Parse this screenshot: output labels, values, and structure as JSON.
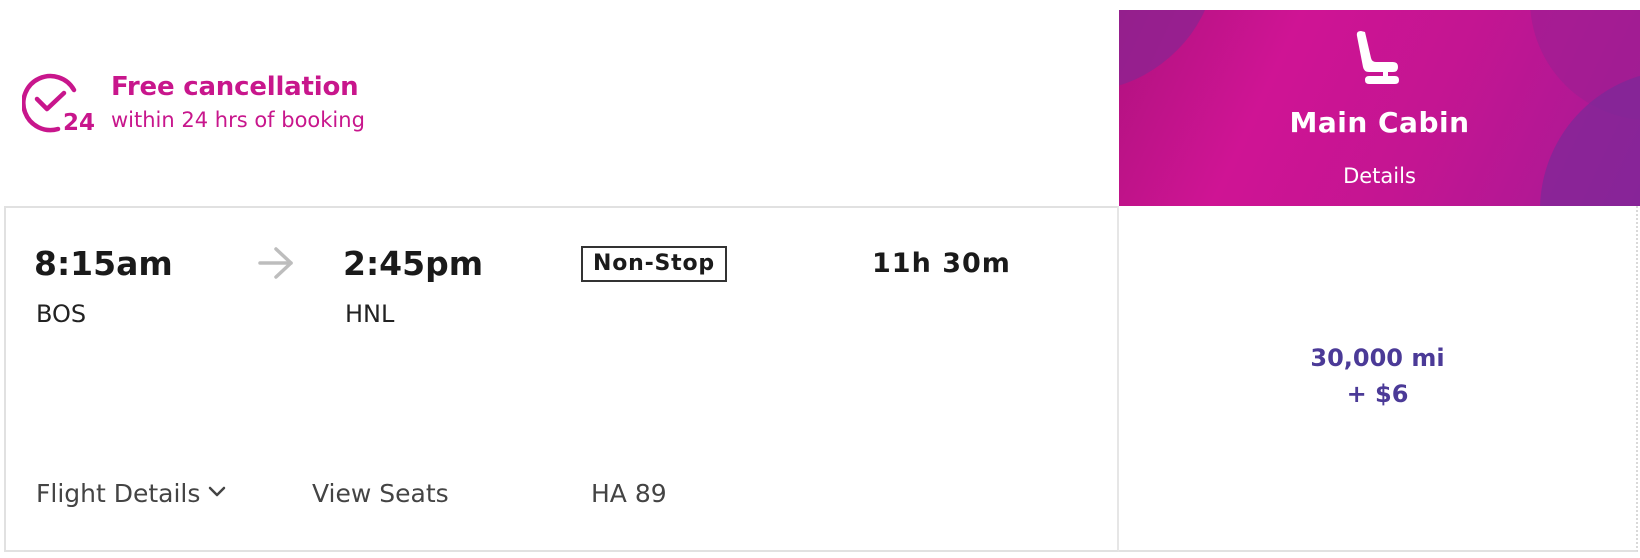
{
  "cancellation": {
    "icon": "clock-check-24-icon",
    "icon_number": "24",
    "title": "Free cancellation",
    "subtitle": "within 24 hrs of booking"
  },
  "cabin": {
    "icon": "seat-icon",
    "title": "Main Cabin",
    "details_label": "Details"
  },
  "flight": {
    "depart_time": "8:15am",
    "depart_airport": "BOS",
    "arrive_time": "2:45pm",
    "arrive_airport": "HNL",
    "stops_label": "Non-Stop",
    "duration": "11h 30m",
    "flight_details_label": "Flight Details",
    "view_seats_label": "View Seats",
    "flight_number": "HA 89"
  },
  "price": {
    "miles": "30,000 mi",
    "fee": "+ $6"
  },
  "colors": {
    "brand_magenta": "#c8168c",
    "brand_purple": "#4b3a97",
    "arrow_gray": "#bdbdbd",
    "border_gray": "#e1e1e1"
  }
}
